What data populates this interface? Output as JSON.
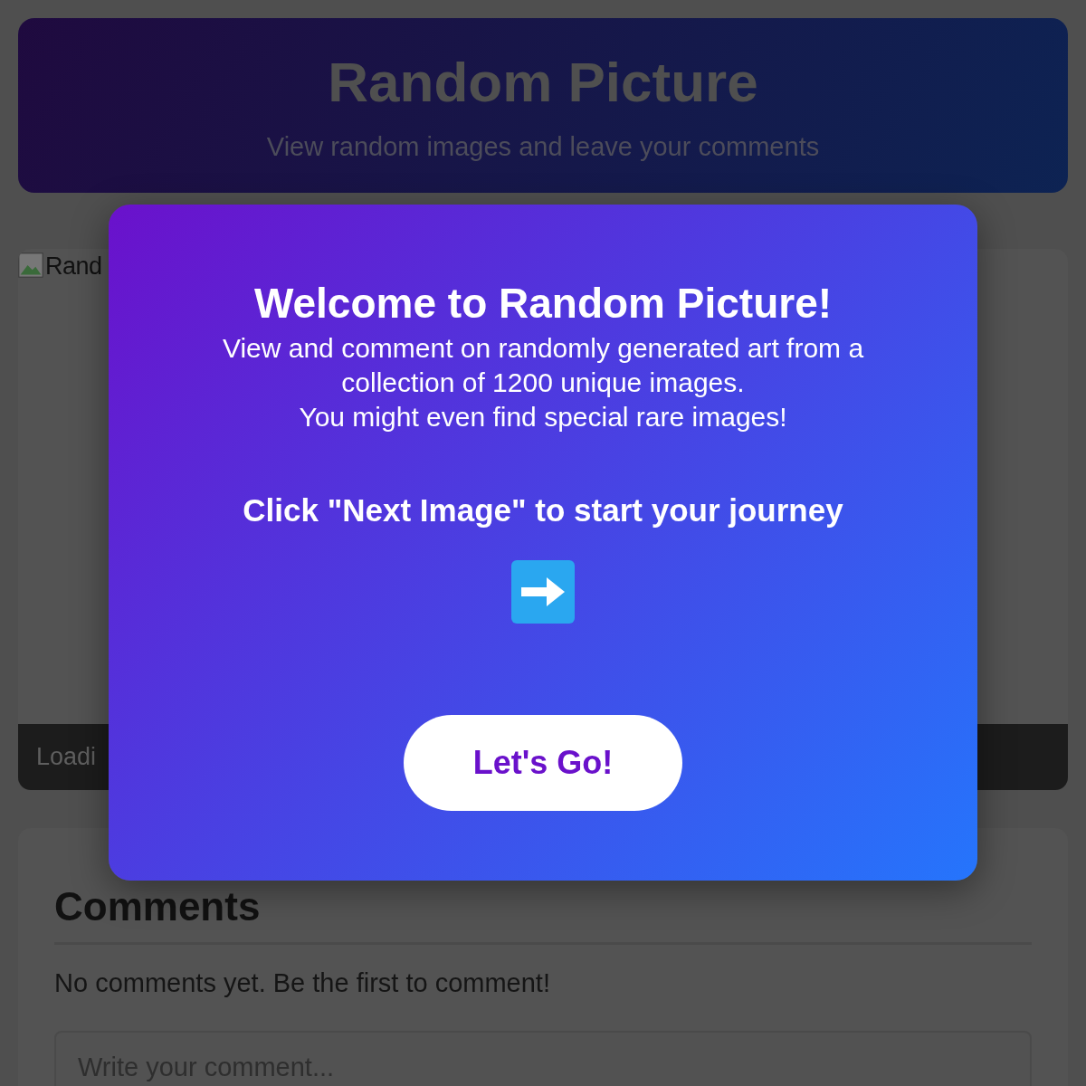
{
  "header": {
    "title": "Random Picture",
    "subtitle": "View random images and leave your comments"
  },
  "image_card": {
    "alt_text": "Rand",
    "status": "Loadi"
  },
  "comments": {
    "title": "Comments",
    "empty_message": "No comments yet. Be the first to comment!",
    "input": {
      "placeholder": "Write your comment..."
    }
  },
  "welcome_modal": {
    "title": "Welcome to Random Picture!",
    "description_lines": [
      "View and comment on randomly generated art from a",
      "collection of 1200 unique images.",
      "You might even find special rare images!"
    ],
    "call_to_action": "Click \"Next Image\" to start your journey",
    "button": "Let's Go!"
  }
}
